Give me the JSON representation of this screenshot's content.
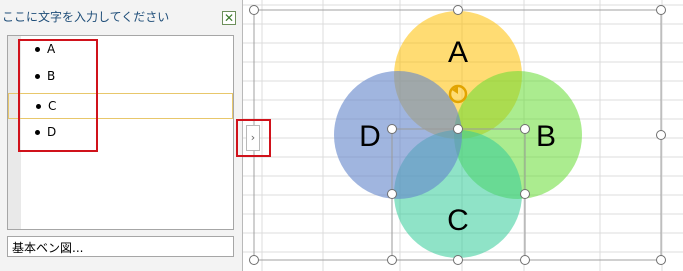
{
  "text_pane": {
    "title": "ここに文字を入力してください",
    "close_icon": "close-icon",
    "items": [
      {
        "label": "A"
      },
      {
        "label": "B"
      },
      {
        "label": "C"
      },
      {
        "label": "D"
      }
    ],
    "selected_index": 2,
    "footer_label": "基本ベン図..."
  },
  "toggle": {
    "icon": "chevron-right-icon",
    "glyph": "›"
  },
  "diagram": {
    "type": "basic-venn",
    "circles": [
      {
        "label": "A",
        "color": "#ffc000"
      },
      {
        "label": "B",
        "color": "#66dd33"
      },
      {
        "label": "C",
        "color": "#33cc99"
      },
      {
        "label": "D",
        "color": "#6688cc"
      }
    ],
    "rotate_icon": "rotate-handle-icon"
  },
  "colors": {
    "highlight": "#d0121b",
    "selection": "#e8c76b"
  }
}
